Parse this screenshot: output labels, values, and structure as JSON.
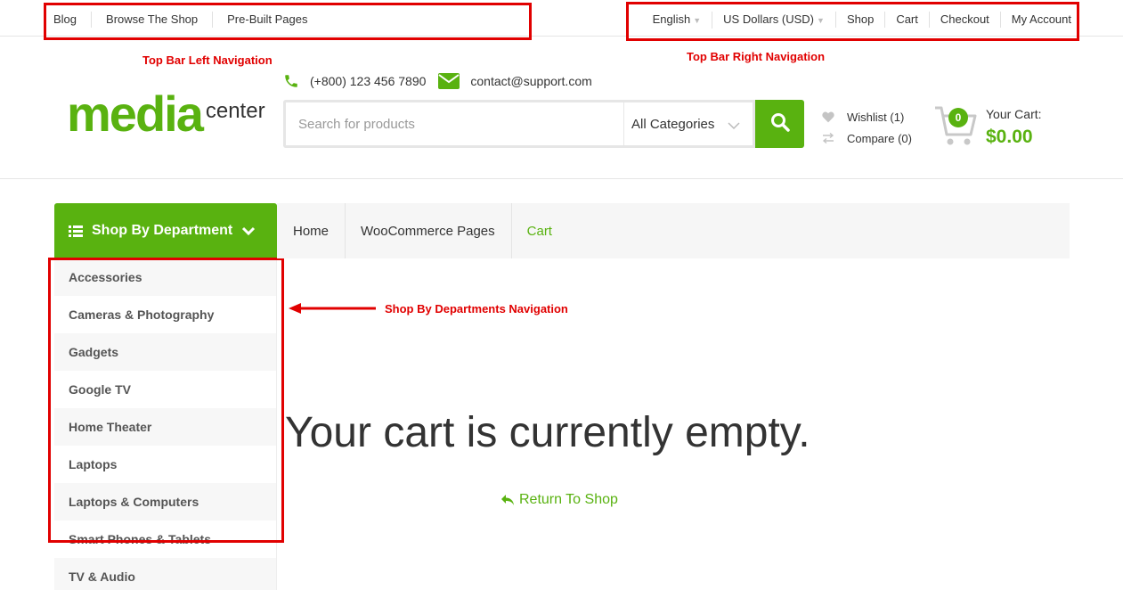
{
  "top_bar": {
    "left_links": [
      "Blog",
      "Browse The Shop",
      "Pre-Built Pages"
    ],
    "language": "English",
    "currency": "US Dollars (USD)",
    "right_links": [
      "Shop",
      "Cart",
      "Checkout",
      "My Account"
    ]
  },
  "annotations": {
    "top_left": "Top Bar Left Navigation",
    "top_right": "Top Bar Right Navigation",
    "departments": "Shop By Departments Navigation",
    "color": "#e10000"
  },
  "logo": {
    "main": "media",
    "sub": "center"
  },
  "contact": {
    "phone": "(+800) 123 456 7890",
    "email": "contact@support.com"
  },
  "search": {
    "placeholder": "Search for products",
    "category": "All Categories"
  },
  "wishlist_label": "Wishlist (1)",
  "compare_label": "Compare (0)",
  "cart": {
    "count": "0",
    "label": "Your Cart:",
    "total": "$0.00"
  },
  "departments": {
    "title": "Shop By Department",
    "items": [
      "Accessories",
      "Cameras & Photography",
      "Gadgets",
      "Google TV",
      "Home Theater",
      "Laptops",
      "Laptops & Computers",
      "Smart Phones & Tablets",
      "TV & Audio"
    ]
  },
  "breadcrumb": [
    "Home",
    "WooCommerce Pages",
    "Cart"
  ],
  "main": {
    "empty_message": "Your cart is currently empty.",
    "return_label": "Return To Shop"
  },
  "colors": {
    "accent": "#59b210",
    "text": "#333333"
  }
}
